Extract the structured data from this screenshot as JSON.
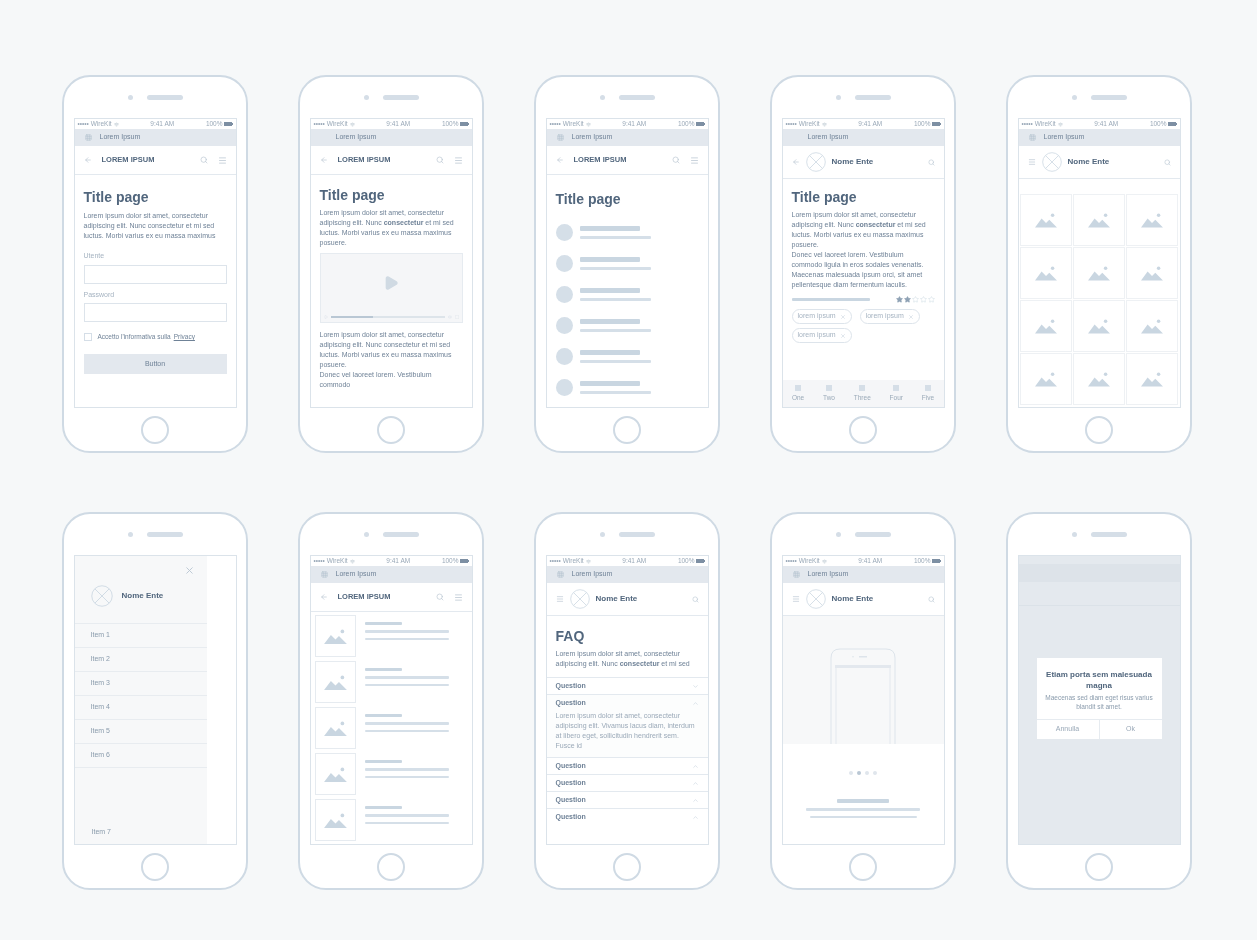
{
  "screens": [
    {
      "kind": "login",
      "status_bar": {
        "carrier": "••••• WireKit",
        "time": "9:41 AM",
        "battery": "100%"
      },
      "app_bar": {
        "label": "Lorem Ipsum",
        "grid_icon": true
      },
      "header": {
        "kind": "text",
        "leading": {
          "kind": "back"
        },
        "title": "LOREM IPSUM"
      },
      "title": "Title page",
      "text": "Lorem ipsum dolor sit amet, consectetur adipiscing elit. Nunc consectetur et mi sed luctus. Morbi varius ex eu massa maximus",
      "fields": [
        {
          "label": "Utente"
        },
        {
          "label": "Password"
        }
      ],
      "checkbox": {
        "label": "Accetto l'informativa sulla",
        "link": "Privacy",
        "checked": false
      },
      "button": "Button"
    },
    {
      "kind": "video",
      "status_bar": {
        "carrier": "••••• WireKit",
        "time": "9:41 AM",
        "battery": "100%"
      },
      "app_bar": {
        "label": "Lorem Ipsum",
        "grid_icon": false
      },
      "header": {
        "kind": "text",
        "leading": {
          "kind": "back"
        },
        "title": "LOREM IPSUM"
      },
      "title": "Title page",
      "text": "Lorem ipsum dolor sit amet, consectetur adipiscing elit. Nunc **consectetur** et mi sed luctus. Morbi varius ex eu massa maximus posuere.",
      "video": {
        "level": 0.37
      },
      "paragraphs": [
        "Lorem ipsum dolor sit amet, consectetur adipiscing elit. Nunc consectetur et mi sed luctus. Morbi varius ex eu massa maximus posuere.",
        "Donec vel laoreet lorem. Vestibulum commodo"
      ]
    },
    {
      "kind": "list",
      "status_bar": {
        "carrier": "••••• WireKit",
        "time": "9:41 AM",
        "battery": "100%"
      },
      "app_bar": {
        "label": "Lorem Ipsum",
        "grid_icon": true
      },
      "header": {
        "kind": "text",
        "leading": {
          "kind": "back"
        },
        "title": "LOREM IPSUM"
      },
      "title": "Title page"
    },
    {
      "kind": "detail",
      "status_bar": {
        "carrier": "••••• WireKit",
        "time": "9:41 AM",
        "battery": "100%"
      },
      "app_bar": {
        "label": "Lorem Ipsum",
        "grid_icon": false
      },
      "header": {
        "kind": "brand",
        "leading": {
          "kind": "back"
        },
        "title": "Nome Ente"
      },
      "title": "Title page",
      "paragraphs": [
        "Lorem ipsum dolor sit amet, consectetur adipiscing elit. Nunc **consectetur** et mi sed luctus. Morbi varius ex eu massa maximus posuere.",
        "Donec vel laoreet lorem. Vestibulum commodo ligula in eros sodales venenatis. Maecenas malesuada ipsum orci, sit amet pellentesque diam fermentum iaculis."
      ],
      "stars": 2,
      "chips": [
        "lorem ipsum",
        "lorem ipsum",
        "lorem ipsum"
      ],
      "tabs": [
        {
          "label": "One"
        },
        {
          "label": "Two"
        },
        {
          "label": "Three"
        },
        {
          "label": "Four"
        },
        {
          "label": "Five"
        }
      ]
    },
    {
      "kind": "gallery",
      "status_bar": {
        "carrier": "••••• WireKit",
        "time": "9:41 AM",
        "battery": "100%"
      },
      "app_bar": {
        "label": "Lorem Ipsum",
        "grid_icon": true
      },
      "header": {
        "kind": "brand",
        "leading": {
          "kind": "menu"
        },
        "title": "Nome Ente"
      }
    },
    {
      "kind": "drawer",
      "title": "Nome Ente",
      "items": [
        "Item 1",
        "Item 2",
        "Item 3",
        "Item 4",
        "Item 5",
        "Item 6"
      ],
      "footer_item": "Item 7"
    },
    {
      "kind": "media_list",
      "status_bar": {
        "carrier": "••••• WireKit",
        "time": "9:41 AM",
        "battery": "100%"
      },
      "app_bar": {
        "label": "Lorem Ipsum",
        "grid_icon": true
      },
      "header": {
        "kind": "text",
        "leading": {
          "kind": "back"
        },
        "title": "LOREM IPSUM"
      }
    },
    {
      "kind": "faq",
      "status_bar": {
        "carrier": "••••• WireKit",
        "time": "9:41 AM",
        "battery": "100%"
      },
      "app_bar": {
        "label": "Lorem Ipsum",
        "grid_icon": true
      },
      "header": {
        "kind": "brand",
        "leading": {
          "kind": "menu"
        },
        "title": "Nome Ente"
      },
      "title": "FAQ",
      "text": "Lorem ipsum dolor sit amet, consectetur adipiscing elit. Nunc **consectetur** et mi sed",
      "questions": [
        {
          "label": "Question",
          "expanded": false,
          "chevron": {
            "kind": "down"
          }
        },
        {
          "label": "Question",
          "expanded": true,
          "chevron": {
            "kind": "up"
          },
          "answer": "Lorem ipsum dolor sit amet, consectetur adipiscing elit. Vivamus lacus diam, interdum at libero eget, sollicitudin hendrerit sem. Fusce id"
        },
        {
          "label": "Question",
          "expanded": false,
          "chevron": {
            "kind": "up"
          }
        },
        {
          "label": "Question",
          "expanded": false,
          "chevron": {
            "kind": "up"
          }
        },
        {
          "label": "Question",
          "expanded": false,
          "chevron": {
            "kind": "up"
          }
        },
        {
          "label": "Question",
          "expanded": false,
          "chevron": {
            "kind": "up"
          }
        }
      ]
    },
    {
      "kind": "onboarding",
      "status_bar": {
        "carrier": "••••• WireKit",
        "time": "9:41 AM",
        "battery": "100%"
      },
      "app_bar": {
        "label": "Lorem Ipsum",
        "grid_icon": true
      },
      "header": {
        "kind": "brand",
        "leading": {
          "kind": "menu"
        },
        "title": "Nome Ente"
      },
      "pager": [
        {
          "selected": false
        },
        {
          "selected": true
        },
        {
          "selected": false
        },
        {
          "selected": false
        }
      ]
    },
    {
      "kind": "dialog",
      "dialog": {
        "title": "Etiam porta sem malesuada magna",
        "text": "Maecenas sed diam eget risus varius blandit sit amet.",
        "buttons": [
          "Annulla",
          "Ok"
        ]
      }
    }
  ]
}
